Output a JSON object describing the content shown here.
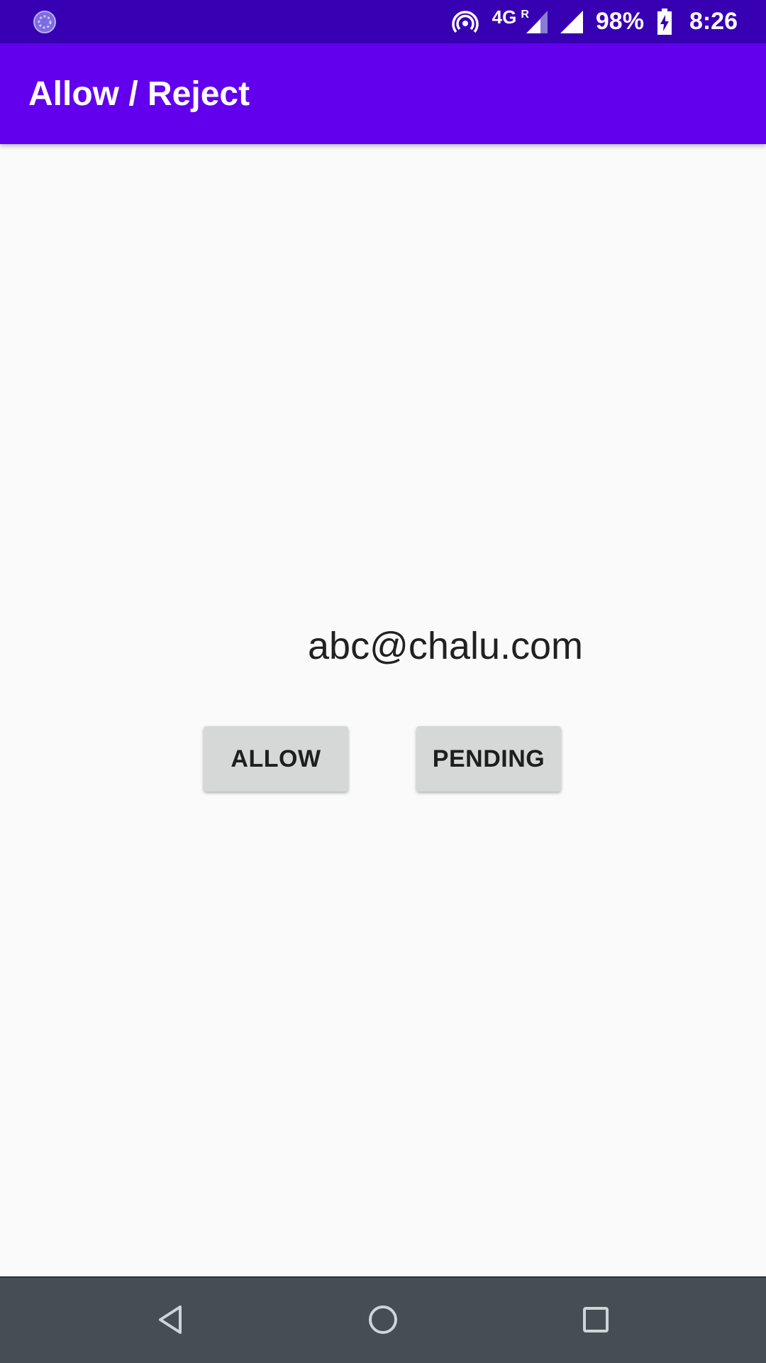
{
  "status_bar": {
    "network_label": "4G",
    "roaming_label": "R",
    "battery_percent": "98%",
    "time": "8:26",
    "left_icon": "loading-circle-icon",
    "icons": [
      "hotspot-icon",
      "signal-r-icon",
      "signal-icon",
      "battery-charging-icon"
    ]
  },
  "app_bar": {
    "title": "Allow / Reject",
    "color": "#6200ee"
  },
  "content": {
    "email": "abc@chalu.com"
  },
  "actions": {
    "allow_label": "ALLOW",
    "pending_label": "PENDING"
  },
  "nav_bar": {
    "icons": [
      "back-icon",
      "home-icon",
      "recents-icon"
    ]
  },
  "colors": {
    "status_bar": "#3700b3",
    "app_bar": "#6200ee",
    "background": "#fafafa",
    "button": "#d6d7d7",
    "nav_bar": "#464e54"
  }
}
